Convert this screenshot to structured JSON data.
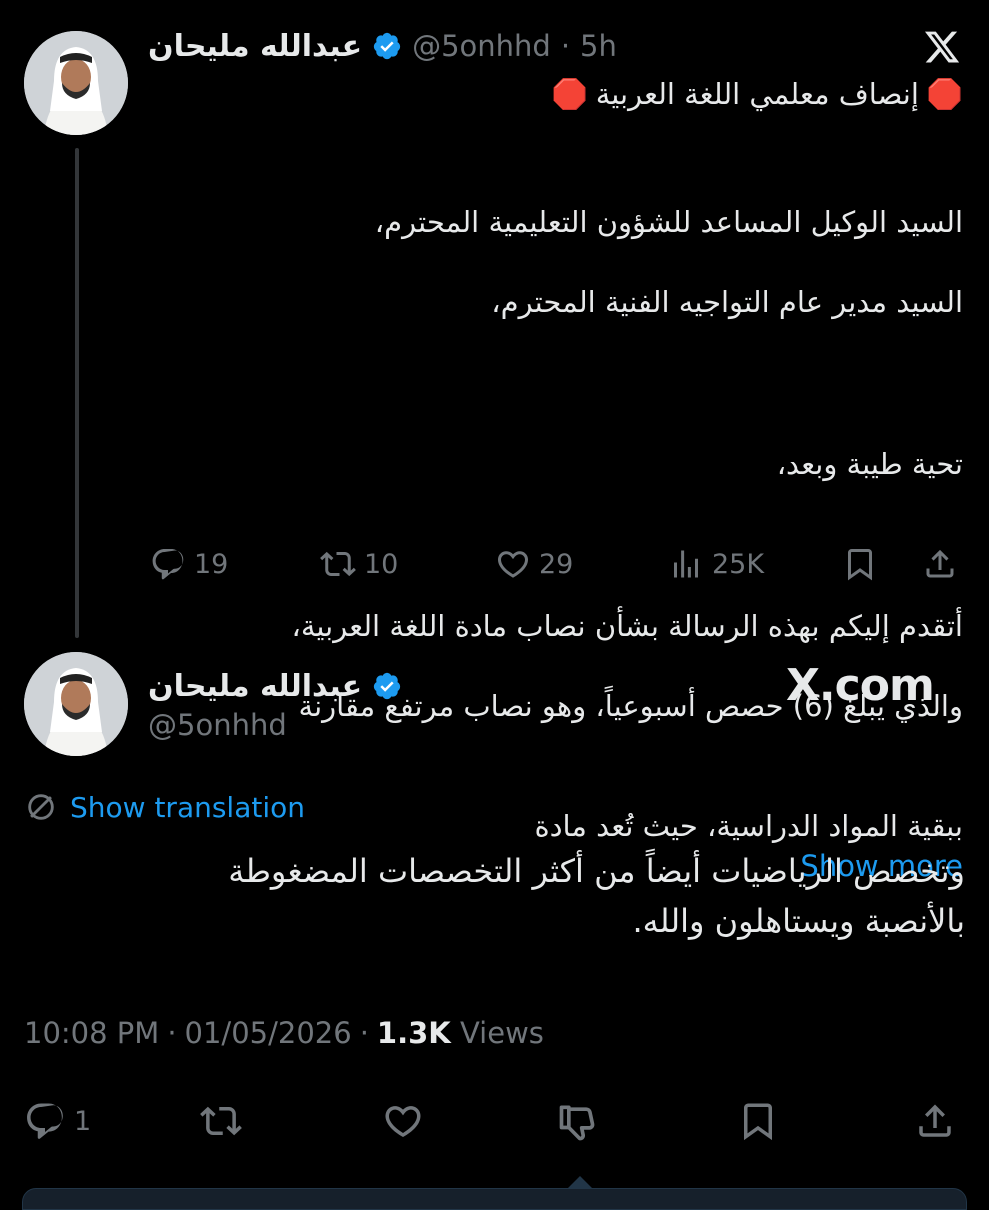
{
  "tweet1": {
    "name": "عبدالله مليحان",
    "handle": "@5onhhd",
    "separator": "·",
    "time": "5h",
    "title": "إنصاف معلمي اللغة العربية",
    "stop_emoji": "🛑",
    "body_lines": [
      "السيد الوكيل المساعد للشؤون التعليمية المحترم،",
      "السيد مدير عام التواجيه الفنية المحترم،",
      "",
      "تحية طيبة وبعد،",
      "",
      "أتقدم إليكم بهذه الرسالة بشأن نصاب مادة اللغة العربية،",
      "والذي يبلغ (6) حصص أسبوعياً، وهو نصاب مرتفع مقارنة"
    ],
    "last_line": "ببقية المواد الدراسية، حيث تُعد مادة",
    "show_more": "Show more",
    "actions": {
      "replies": "19",
      "reposts": "10",
      "likes": "29",
      "views": "25K"
    }
  },
  "tweet2": {
    "name": "عبدالله مليحان",
    "handle": "@5onhhd",
    "watermark": "X.com",
    "show_translation": "Show translation",
    "body_lines": [
      "وتخصص الرياضيات أيضاً من أكثر التخصصات المضغوطة",
      "بالأنصبة ويستاهلون والله."
    ],
    "meta": {
      "time": "10:08 PM",
      "date": "01/05/2026",
      "views_count": "1.3K",
      "views_label": "Views",
      "dot": "·"
    },
    "actions": {
      "replies": "1"
    }
  },
  "colors": {
    "accent": "#1d9bf0",
    "muted": "#71767b",
    "text": "#e7e9ea",
    "line": "#333639"
  },
  "icons": [
    "x-logo-icon",
    "verified-icon",
    "reply-icon",
    "repost-icon",
    "like-icon",
    "views-icon",
    "bookmark-icon",
    "share-icon",
    "translate-icon",
    "dislike-icon"
  ]
}
